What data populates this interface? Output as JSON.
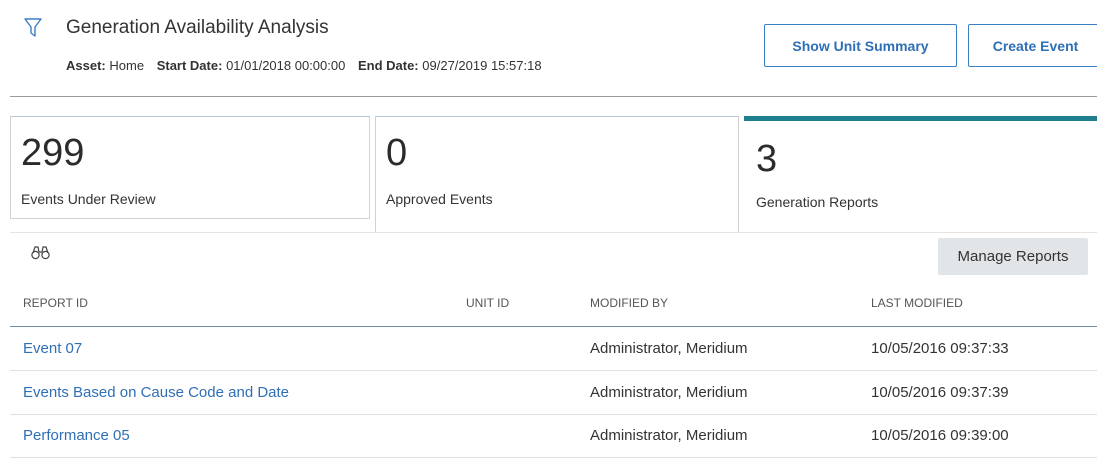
{
  "header": {
    "title": "Generation Availability Analysis",
    "asset_label": "Asset:",
    "asset_value": "Home",
    "start_label": "Start Date:",
    "start_value": "01/01/2018 00:00:00",
    "end_label": "End Date:",
    "end_value": "09/27/2019 15:57:18",
    "filter_icon": "filter-icon"
  },
  "actions": {
    "show_unit_summary": "Show Unit Summary",
    "create_event": "Create Event"
  },
  "tiles": [
    {
      "count": "299",
      "label": "Events Under Review"
    },
    {
      "count": "0",
      "label": "Approved Events"
    },
    {
      "count": "3",
      "label": "Generation Reports",
      "active": true
    }
  ],
  "reports": {
    "search_icon": "binoculars-icon",
    "manage_label": "Manage Reports",
    "columns": [
      "REPORT ID",
      "UNIT ID",
      "MODIFIED BY",
      "LAST MODIFIED"
    ],
    "rows": [
      {
        "report_id": "Event 07",
        "unit_id": "",
        "modified_by": "Administrator, Meridium",
        "last_modified": "10/05/2016 09:37:33"
      },
      {
        "report_id": "Events Based on Cause Code and Date",
        "unit_id": "",
        "modified_by": "Administrator, Meridium",
        "last_modified": "10/05/2016 09:37:39"
      },
      {
        "report_id": "Performance 05",
        "unit_id": "",
        "modified_by": "Administrator, Meridium",
        "last_modified": "10/05/2016 09:39:00"
      }
    ]
  },
  "colors": {
    "accent": "#2f6fb5",
    "active_tab": "#1f7f8f",
    "manage_button_bg": "#e2e5e8"
  }
}
